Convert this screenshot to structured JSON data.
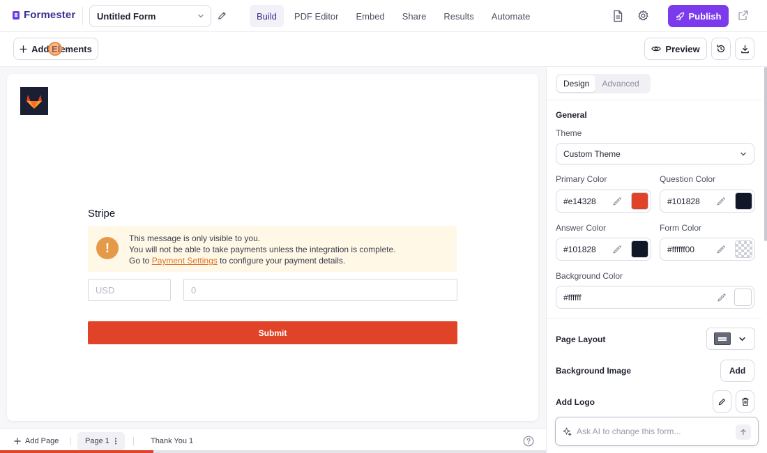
{
  "app": {
    "brand_name": "Formester",
    "brand_color": "#6b3fe0"
  },
  "header": {
    "form_title": "Untitled Form",
    "nav": [
      "Build",
      "PDF Editor",
      "Embed",
      "Share",
      "Results",
      "Automate"
    ],
    "active_nav": "Build",
    "publish_label": "Publish",
    "publish_color": "#7c3aed"
  },
  "toolbar": {
    "add_elements_label": "Add Elements",
    "preview_label": "Preview"
  },
  "form": {
    "logo": "gitlab-fox-logo",
    "field_label": "Stripe",
    "notice": {
      "line1": "This message is only visible to you.",
      "line2": "You will not be able to take payments unless the integration is complete.",
      "line3_prefix": "Go to",
      "line3_link": "Payment Settings",
      "line3_suffix": "to configure your payment details."
    },
    "currency_placeholder": "USD",
    "amount_placeholder": "0",
    "submit_label": "Submit",
    "submit_color": "#e14328"
  },
  "pages": {
    "add_page_label": "Add Page",
    "page_tab_label": "Page 1",
    "thank_you_label": "Thank You 1"
  },
  "progress": {
    "value": 0.2
  },
  "design_panel": {
    "tabs": [
      "Design",
      "Advanced"
    ],
    "active_tab": "Design",
    "general_heading": "General",
    "theme_label": "Theme",
    "theme_value": "Custom Theme",
    "colors": [
      {
        "label": "Primary Color",
        "value": "#e14328",
        "swatch": "#e14328"
      },
      {
        "label": "Question Color",
        "value": "#101828",
        "swatch": "#101828"
      },
      {
        "label": "Answer Color",
        "value": "#101828",
        "swatch": "#101828"
      },
      {
        "label": "Form Color",
        "value": "#ffffff00",
        "swatch": "transparent"
      },
      {
        "label": "Background Color",
        "value": "#ffffff",
        "swatch": "#ffffff"
      }
    ],
    "page_layout_label": "Page Layout",
    "background_image_label": "Background Image",
    "background_image_button": "Add",
    "add_logo_label": "Add Logo"
  },
  "ai": {
    "placeholder": "Ask AI to change this form..."
  }
}
